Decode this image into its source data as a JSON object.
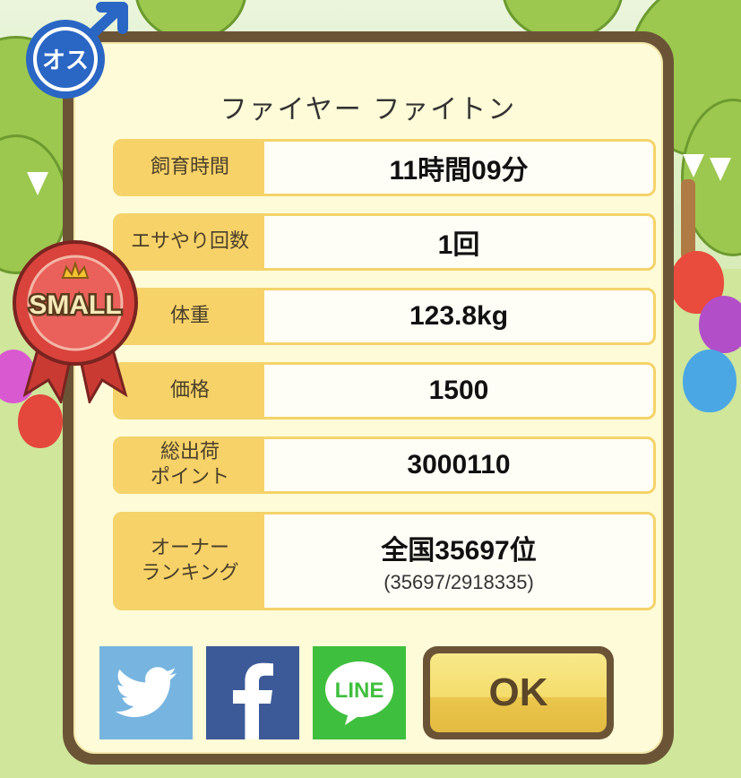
{
  "pet_name": "ファイヤー ファイトン",
  "gender_badge": {
    "label": "オス",
    "icon": "male-symbol-icon",
    "color": "#2a66c4"
  },
  "size_ribbon": {
    "label": "SMALL",
    "icon": "crown-icon",
    "color": "#d9433c"
  },
  "stats": [
    {
      "label": "飼育時間",
      "value": "11時間09分"
    },
    {
      "label": "エサやり回数",
      "value": "1回"
    },
    {
      "label": "体重",
      "value": "123.8kg"
    },
    {
      "label": "価格",
      "value": "1500"
    },
    {
      "label": "総出荷\nポイント",
      "value": "3000110"
    },
    {
      "label": "オーナー\nランキング",
      "value": "全国35697位",
      "sub": "(35697/2918335)"
    }
  ],
  "share_buttons": {
    "twitter": {
      "icon": "twitter-bird-icon",
      "color": "#77b5e0"
    },
    "facebook": {
      "icon": "facebook-f-icon",
      "color": "#3c5a98"
    },
    "line": {
      "label": "LINE",
      "icon": "line-chat-icon",
      "color": "#3fbf3e"
    }
  },
  "ok_button": {
    "label": "OK"
  },
  "colors": {
    "panel_border": "#6b5436",
    "panel_fill": "#fefbd8",
    "label_fill": "#f7d268"
  }
}
